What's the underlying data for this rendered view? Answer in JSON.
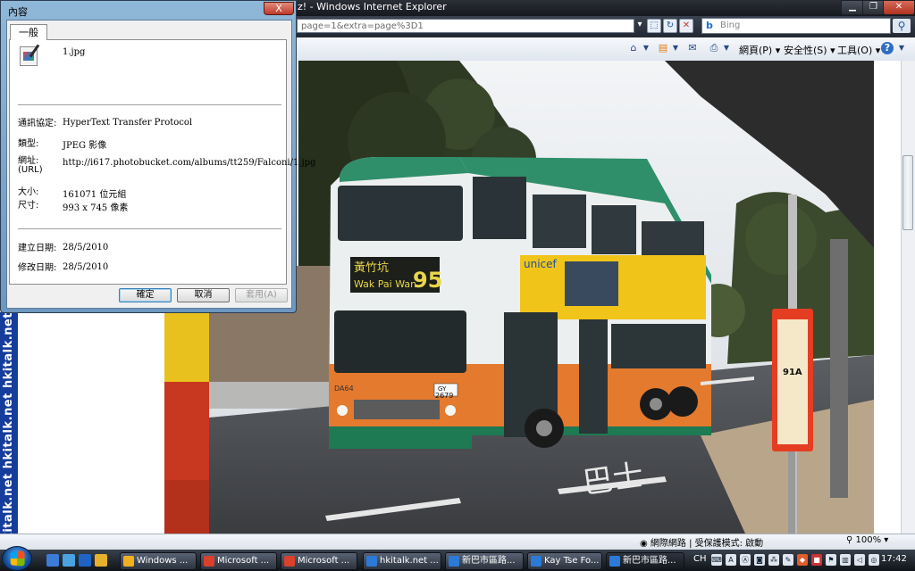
{
  "browser": {
    "title": "uz! - Windows Internet Explorer",
    "address": "page=1&extra=page%3D1",
    "search_placeholder": "Bing",
    "menus": [
      "網頁(P)",
      "安全性(S)",
      "工具(O)"
    ],
    "help_icon": "?"
  },
  "sidebar": {
    "banner_text": "hkitalk.net  hkitalk.net  hkitalk.net"
  },
  "statusbar": {
    "zone": "網際網路 | 受保護模式: 啟動",
    "zoom": "100%"
  },
  "taskbar": {
    "buttons": [
      {
        "label": "Windows ...",
        "color": "#f2b01e"
      },
      {
        "label": "Microsoft ...",
        "color": "#d9412c"
      },
      {
        "label": "Microsoft ...",
        "color": "#d9412c"
      },
      {
        "label": "hkitalk.net ...",
        "color": "#2b7ad8"
      },
      {
        "label": "新巴市區路...",
        "color": "#2b7ad8"
      },
      {
        "label": "Kay Tse Fo...",
        "color": "#2b7ad8"
      },
      {
        "label": "新巴市區路...",
        "color": "#2b7ad8"
      }
    ],
    "lang": "CH",
    "clock": "17:42"
  },
  "dialog": {
    "title": "內容",
    "close_glyph": "X",
    "tab_general": "一般",
    "filename": "1.jpg",
    "protocol_label": "通訊協定:",
    "protocol_value": "HyperText Transfer Protocol",
    "type_label": "類型:",
    "type_value": "JPEG 影像",
    "address_label": "網址:",
    "address_label2": "(URL)",
    "address_value": "http://i617.photobucket.com/albums/tt259/Falconi/1.jpg",
    "size_label": "大小:",
    "size_value": "161071 位元組",
    "dimensions_label": "尺寸:",
    "dimensions_value": "993 x 745 像素",
    "created_label": "建立日期:",
    "created_value": "28/5/2010",
    "modified_label": "修改日期:",
    "modified_value": "28/5/2010",
    "ok_label": "確定",
    "cancel_label": "取消",
    "apply_label": "套用(A)"
  },
  "photo": {
    "bus_destination_cn": "黃竹坑",
    "bus_destination_en": "Wak Pai Wan",
    "bus_route": "95",
    "bus_fleet_no": "DA64",
    "plate_line1": "GY",
    "plate_line2": "2679",
    "ad_brand": "unicef",
    "stop_route": "91A",
    "road_marking": "巴士"
  }
}
